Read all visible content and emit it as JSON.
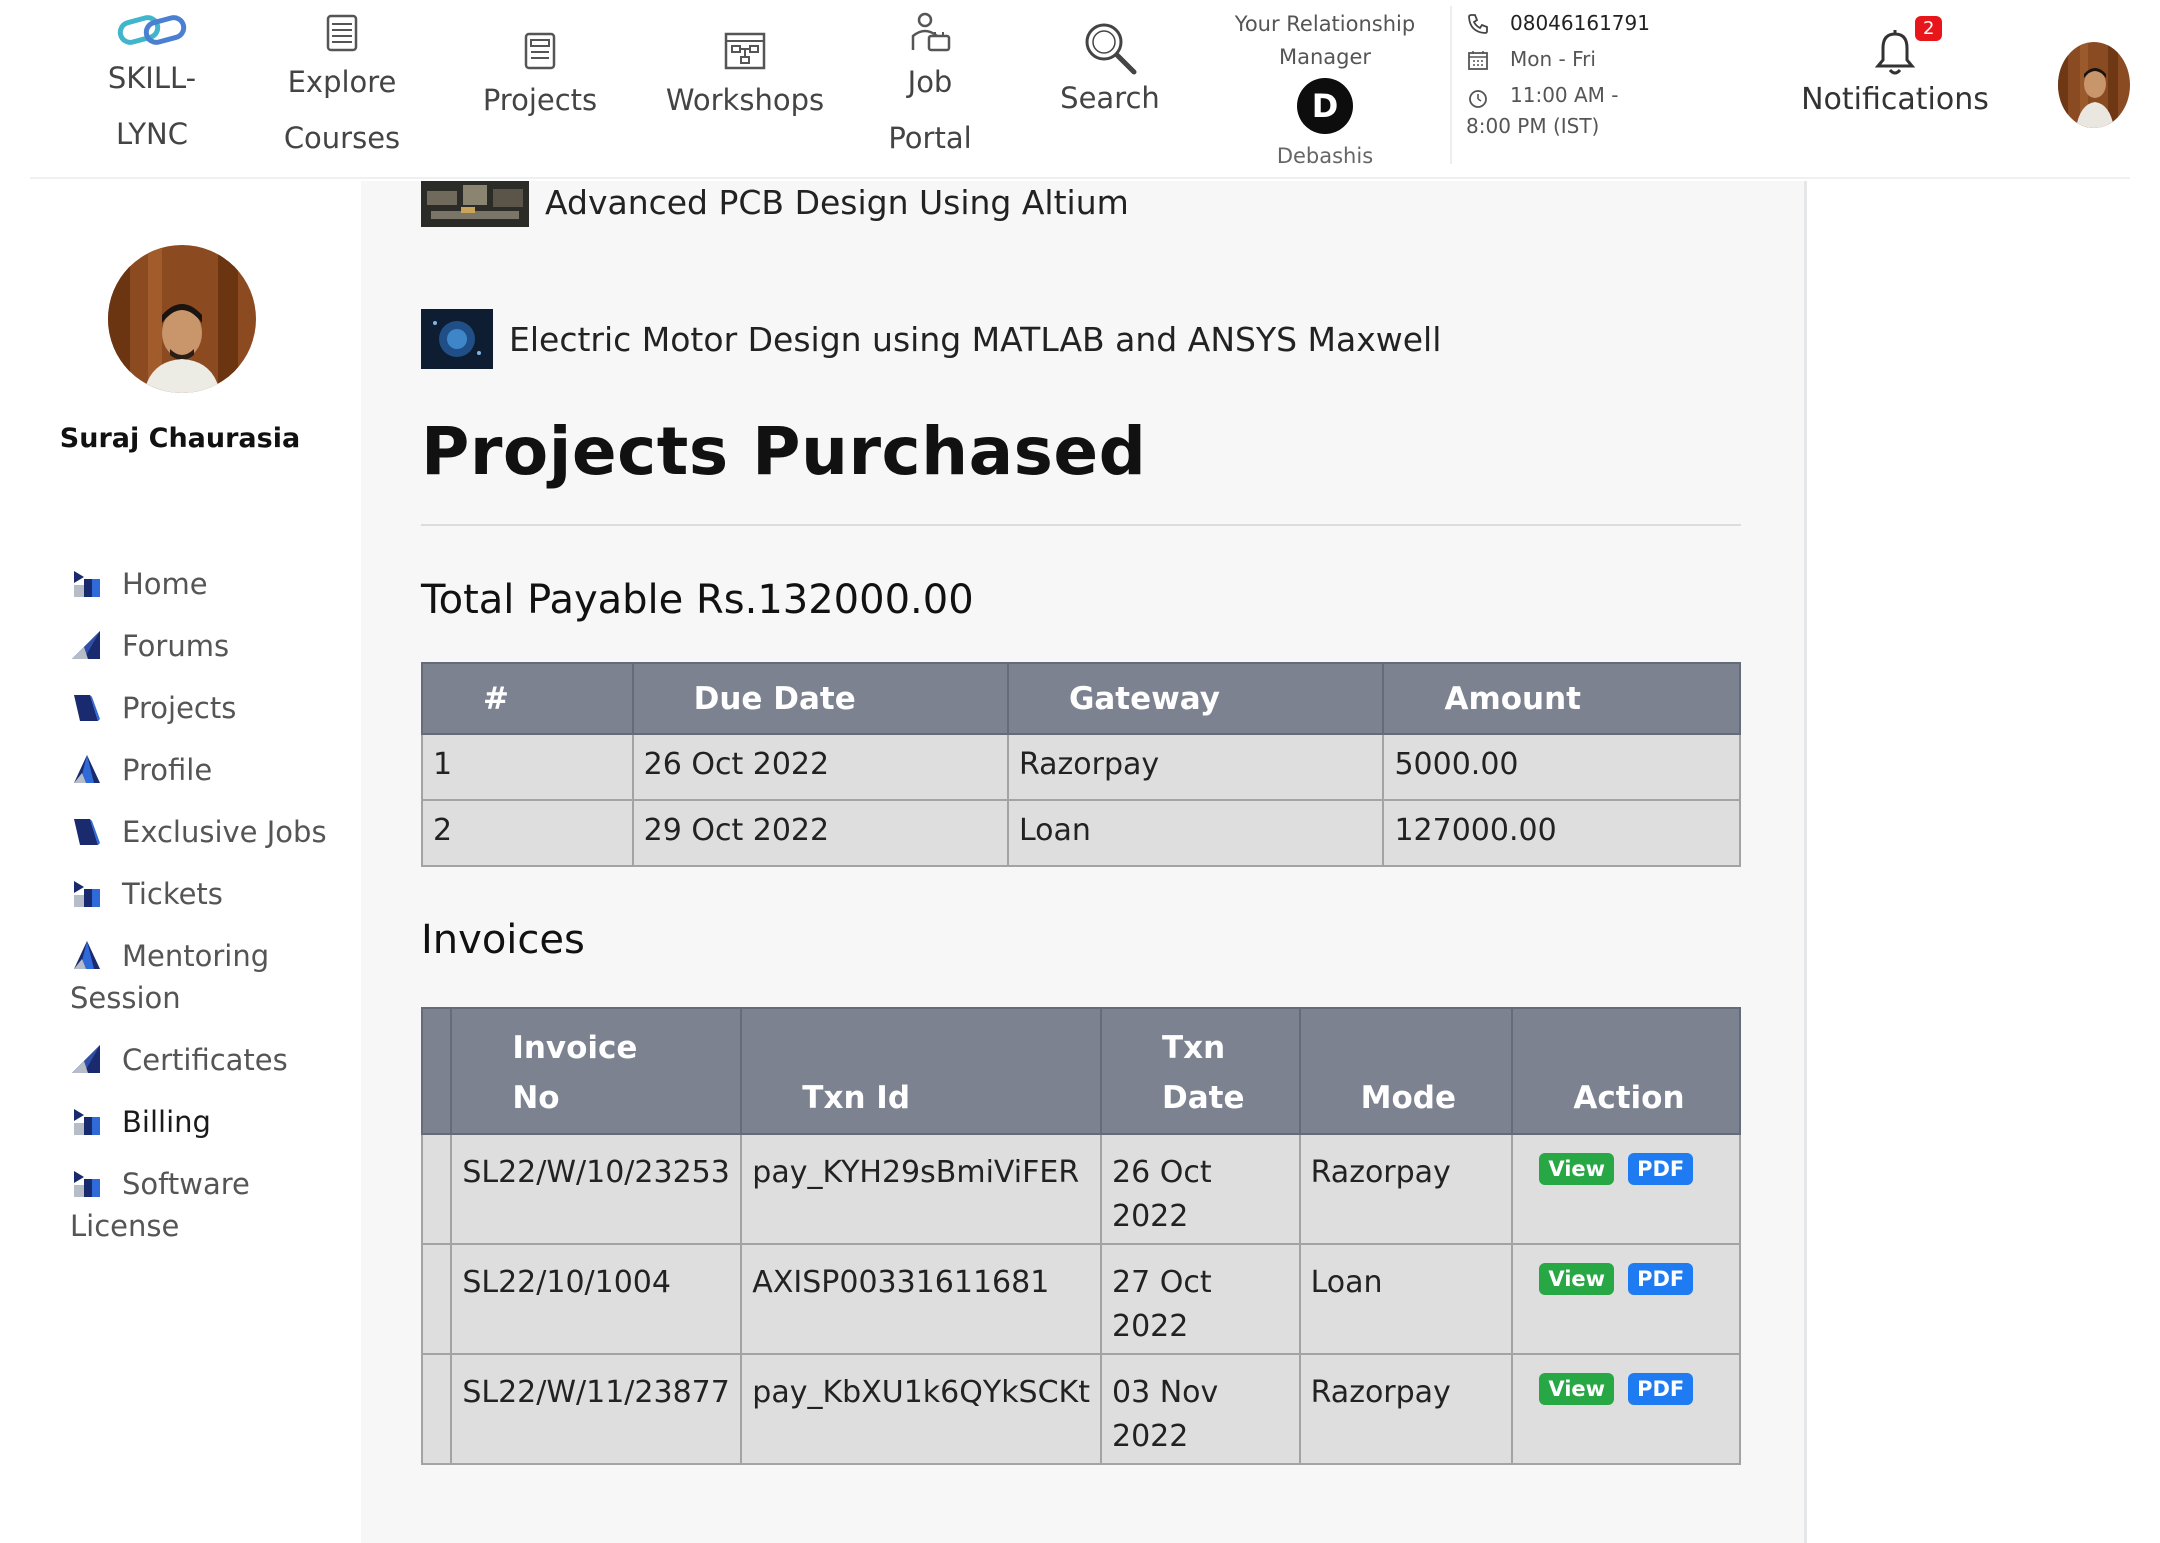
{
  "nav": {
    "logo_line1": "SKILL-",
    "logo_line2": "LYNC",
    "explore_line1": "Explore",
    "explore_line2": "Courses",
    "projects": "Projects",
    "workshops": "Workshops",
    "job_line1": "Job",
    "job_line2": "Portal",
    "search": "Search",
    "notifications": "Notifications",
    "notification_count": "2"
  },
  "relationship_manager": {
    "label_line1": "Your Relationship",
    "label_line2": "Manager",
    "initial": "D",
    "name": "Debashis"
  },
  "contact": {
    "phone": "08046161791",
    "days": "Mon - Fri",
    "hours_line1": "11:00 AM -",
    "hours_line2": "8:00 PM (IST)"
  },
  "user": {
    "name": "Suraj Chaurasia"
  },
  "sidebar": {
    "items": [
      {
        "label": "Home"
      },
      {
        "label": "Forums"
      },
      {
        "label": "Projects"
      },
      {
        "label": "Profile"
      },
      {
        "label": "Exclusive Jobs"
      },
      {
        "label": "Tickets"
      },
      {
        "label": "Mentoring",
        "label2": "Session"
      },
      {
        "label": "Certificates"
      },
      {
        "label": "Billing"
      },
      {
        "label": "Software",
        "label2": "License"
      }
    ]
  },
  "courses": [
    {
      "title": "Advanced PCB Design Using Altium"
    },
    {
      "title": "Electric Motor Design using MATLAB and ANSYS Maxwell"
    }
  ],
  "main": {
    "heading": "Projects Purchased",
    "total_payable": "Total Payable Rs.132000.00",
    "invoices_heading": "Invoices"
  },
  "payments_table": {
    "headers": [
      "#",
      "Due Date",
      "Gateway",
      "Amount"
    ],
    "rows": [
      [
        "1",
        "26 Oct 2022",
        "Razorpay",
        "5000.00"
      ],
      [
        "2",
        "29 Oct 2022",
        "Loan",
        "127000.00"
      ]
    ]
  },
  "invoices_table": {
    "headers": [
      {
        "line1": "Invoice",
        "line2": "No"
      },
      {
        "line1": "",
        "line2": "Txn Id"
      },
      {
        "line1": "Txn",
        "line2": "Date"
      },
      {
        "line1": "",
        "line2": "Mode"
      },
      {
        "line1": "",
        "line2": "Action"
      }
    ],
    "view_label": "View",
    "pdf_label": "PDF",
    "rows": [
      {
        "invoice_no": "SL22/W/10/23253",
        "txn_id": "pay_KYH29sBmiViFER",
        "date_line1": "26 Oct",
        "date_line2": "2022",
        "mode": "Razorpay"
      },
      {
        "invoice_no": "SL22/10/1004",
        "txn_id": "AXISP00331611681",
        "date_line1": "27 Oct",
        "date_line2": "2022",
        "mode": "Loan"
      },
      {
        "invoice_no": "SL22/W/11/23877",
        "txn_id": "pay_KbXU1k6QYkSCKt",
        "date_line1": "03 Nov",
        "date_line2": "2022",
        "mode": "Razorpay"
      }
    ]
  },
  "colors": {
    "table_header": "#7d8290",
    "table_cell": "#dedede",
    "view_button": "#28a745",
    "pdf_button": "#1e7bf2",
    "badge": "#e8161b",
    "brand_logo": "#3fb6cc"
  }
}
